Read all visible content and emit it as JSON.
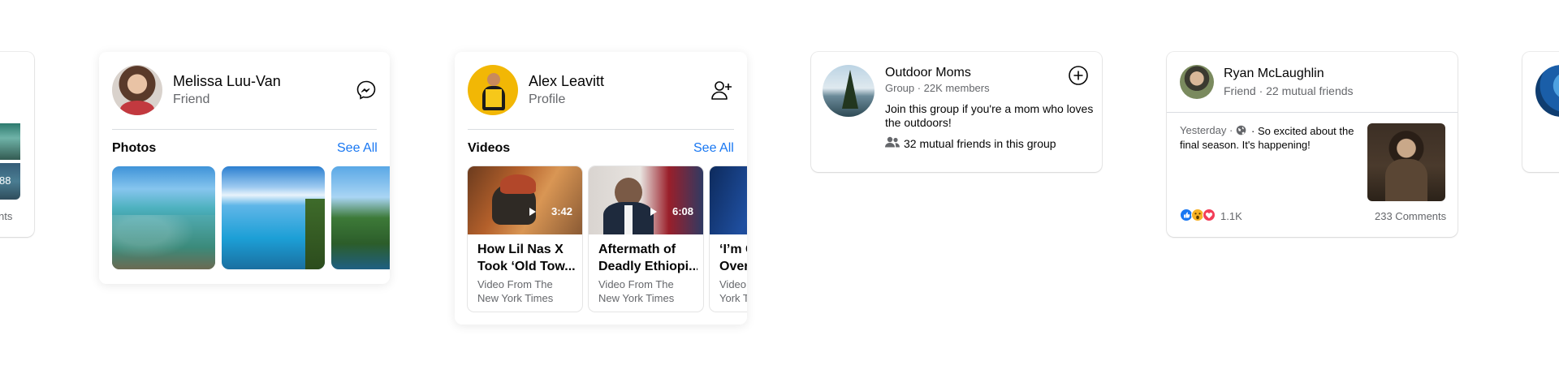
{
  "left_edge_card": {
    "count": "88",
    "comments": "ments"
  },
  "card_melissa": {
    "name": "Melissa Luu-Van",
    "relation": "Friend",
    "action_icon": "messenger-icon",
    "section_title": "Photos",
    "see_all": "See All"
  },
  "card_alex": {
    "name": "Alex Leavitt",
    "relation": "Profile",
    "action_icon": "add-friend-icon",
    "section_title": "Videos",
    "see_all": "See All",
    "videos": [
      {
        "duration": "3:42",
        "title_line1": "How Lil Nas X",
        "title_line2": "Took ‘Old Tow...",
        "source_line1": "Video From The",
        "source_line2": "New York Times"
      },
      {
        "duration": "6:08",
        "title_line1": "Aftermath of",
        "title_line2": "Deadly Ethiopi...",
        "source_line1": "Video From The",
        "source_line2": "New York Times"
      },
      {
        "duration": "",
        "title_line1": "‘I’m Co",
        "title_line2": "Overw",
        "source_line1": "Video I",
        "source_line2": "York Ti"
      }
    ]
  },
  "card_group": {
    "name": "Outdoor Moms",
    "meta": "Group · 22K members",
    "description_line1": "Join this group if you're a mom who loves",
    "description_line2": "the outdoors!",
    "mutual": "32 mutual friends in this group",
    "action_icon": "add-circle-icon"
  },
  "card_ryan": {
    "name": "Ryan McLaughlin",
    "meta": "Friend · 22 mutual friends",
    "post_time": "Yesterday ·",
    "post_text_line1": "· So excited about the",
    "post_text_line2": "final season. It's happening!",
    "reactions_count": "1.1K",
    "comments": "233 Comments"
  },
  "colors": {
    "accent": "#1877f2",
    "secondary_text": "#65676b",
    "divider": "#dadde1"
  }
}
